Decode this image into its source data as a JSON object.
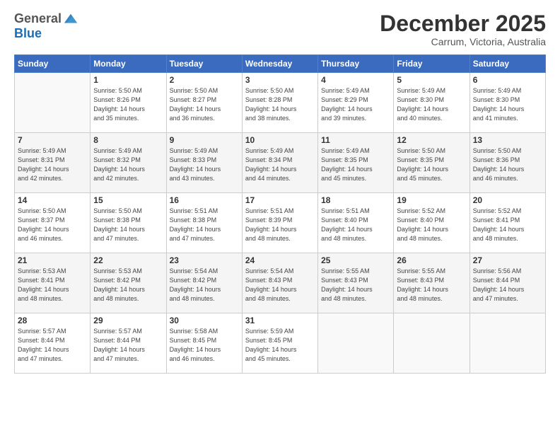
{
  "header": {
    "logo_general": "General",
    "logo_blue": "Blue",
    "month_title": "December 2025",
    "location": "Carrum, Victoria, Australia"
  },
  "calendar": {
    "days_of_week": [
      "Sunday",
      "Monday",
      "Tuesday",
      "Wednesday",
      "Thursday",
      "Friday",
      "Saturday"
    ],
    "weeks": [
      [
        {
          "day": "",
          "info": ""
        },
        {
          "day": "1",
          "info": "Sunrise: 5:50 AM\nSunset: 8:26 PM\nDaylight: 14 hours\nand 35 minutes."
        },
        {
          "day": "2",
          "info": "Sunrise: 5:50 AM\nSunset: 8:27 PM\nDaylight: 14 hours\nand 36 minutes."
        },
        {
          "day": "3",
          "info": "Sunrise: 5:50 AM\nSunset: 8:28 PM\nDaylight: 14 hours\nand 38 minutes."
        },
        {
          "day": "4",
          "info": "Sunrise: 5:49 AM\nSunset: 8:29 PM\nDaylight: 14 hours\nand 39 minutes."
        },
        {
          "day": "5",
          "info": "Sunrise: 5:49 AM\nSunset: 8:30 PM\nDaylight: 14 hours\nand 40 minutes."
        },
        {
          "day": "6",
          "info": "Sunrise: 5:49 AM\nSunset: 8:30 PM\nDaylight: 14 hours\nand 41 minutes."
        }
      ],
      [
        {
          "day": "7",
          "info": "Sunrise: 5:49 AM\nSunset: 8:31 PM\nDaylight: 14 hours\nand 42 minutes."
        },
        {
          "day": "8",
          "info": "Sunrise: 5:49 AM\nSunset: 8:32 PM\nDaylight: 14 hours\nand 42 minutes."
        },
        {
          "day": "9",
          "info": "Sunrise: 5:49 AM\nSunset: 8:33 PM\nDaylight: 14 hours\nand 43 minutes."
        },
        {
          "day": "10",
          "info": "Sunrise: 5:49 AM\nSunset: 8:34 PM\nDaylight: 14 hours\nand 44 minutes."
        },
        {
          "day": "11",
          "info": "Sunrise: 5:49 AM\nSunset: 8:35 PM\nDaylight: 14 hours\nand 45 minutes."
        },
        {
          "day": "12",
          "info": "Sunrise: 5:50 AM\nSunset: 8:35 PM\nDaylight: 14 hours\nand 45 minutes."
        },
        {
          "day": "13",
          "info": "Sunrise: 5:50 AM\nSunset: 8:36 PM\nDaylight: 14 hours\nand 46 minutes."
        }
      ],
      [
        {
          "day": "14",
          "info": "Sunrise: 5:50 AM\nSunset: 8:37 PM\nDaylight: 14 hours\nand 46 minutes."
        },
        {
          "day": "15",
          "info": "Sunrise: 5:50 AM\nSunset: 8:38 PM\nDaylight: 14 hours\nand 47 minutes."
        },
        {
          "day": "16",
          "info": "Sunrise: 5:51 AM\nSunset: 8:38 PM\nDaylight: 14 hours\nand 47 minutes."
        },
        {
          "day": "17",
          "info": "Sunrise: 5:51 AM\nSunset: 8:39 PM\nDaylight: 14 hours\nand 48 minutes."
        },
        {
          "day": "18",
          "info": "Sunrise: 5:51 AM\nSunset: 8:40 PM\nDaylight: 14 hours\nand 48 minutes."
        },
        {
          "day": "19",
          "info": "Sunrise: 5:52 AM\nSunset: 8:40 PM\nDaylight: 14 hours\nand 48 minutes."
        },
        {
          "day": "20",
          "info": "Sunrise: 5:52 AM\nSunset: 8:41 PM\nDaylight: 14 hours\nand 48 minutes."
        }
      ],
      [
        {
          "day": "21",
          "info": "Sunrise: 5:53 AM\nSunset: 8:41 PM\nDaylight: 14 hours\nand 48 minutes."
        },
        {
          "day": "22",
          "info": "Sunrise: 5:53 AM\nSunset: 8:42 PM\nDaylight: 14 hours\nand 48 minutes."
        },
        {
          "day": "23",
          "info": "Sunrise: 5:54 AM\nSunset: 8:42 PM\nDaylight: 14 hours\nand 48 minutes."
        },
        {
          "day": "24",
          "info": "Sunrise: 5:54 AM\nSunset: 8:43 PM\nDaylight: 14 hours\nand 48 minutes."
        },
        {
          "day": "25",
          "info": "Sunrise: 5:55 AM\nSunset: 8:43 PM\nDaylight: 14 hours\nand 48 minutes."
        },
        {
          "day": "26",
          "info": "Sunrise: 5:55 AM\nSunset: 8:43 PM\nDaylight: 14 hours\nand 48 minutes."
        },
        {
          "day": "27",
          "info": "Sunrise: 5:56 AM\nSunset: 8:44 PM\nDaylight: 14 hours\nand 47 minutes."
        }
      ],
      [
        {
          "day": "28",
          "info": "Sunrise: 5:57 AM\nSunset: 8:44 PM\nDaylight: 14 hours\nand 47 minutes."
        },
        {
          "day": "29",
          "info": "Sunrise: 5:57 AM\nSunset: 8:44 PM\nDaylight: 14 hours\nand 47 minutes."
        },
        {
          "day": "30",
          "info": "Sunrise: 5:58 AM\nSunset: 8:45 PM\nDaylight: 14 hours\nand 46 minutes."
        },
        {
          "day": "31",
          "info": "Sunrise: 5:59 AM\nSunset: 8:45 PM\nDaylight: 14 hours\nand 45 minutes."
        },
        {
          "day": "",
          "info": ""
        },
        {
          "day": "",
          "info": ""
        },
        {
          "day": "",
          "info": ""
        }
      ]
    ]
  }
}
